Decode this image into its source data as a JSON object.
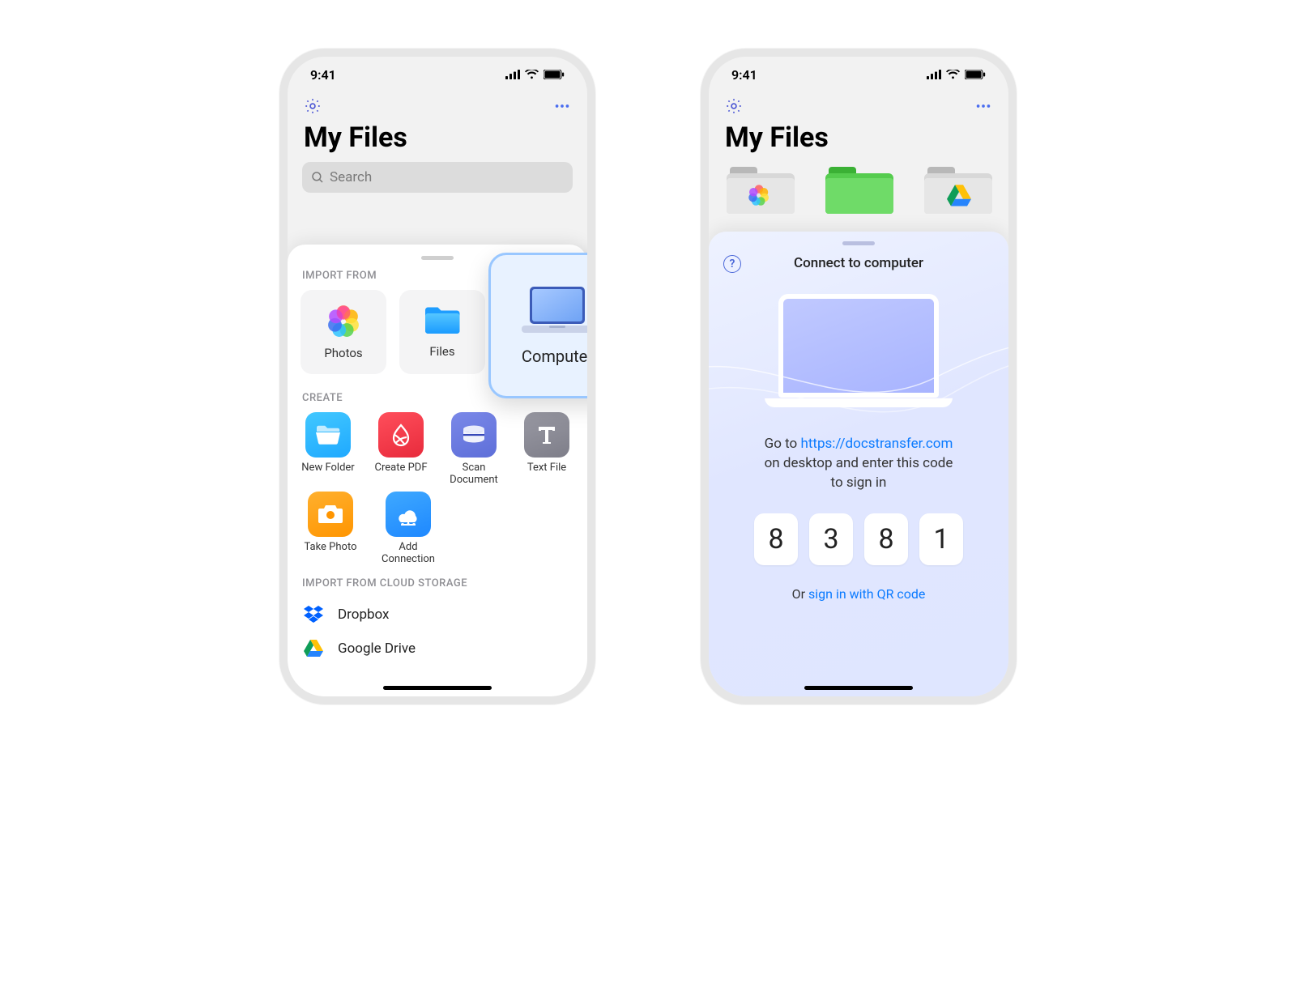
{
  "status_time": "9:41",
  "page_title": "My Files",
  "search_placeholder": "Search",
  "sheet1": {
    "import_label": "IMPORT FROM",
    "photos": "Photos",
    "files": "Files",
    "computer": "Computer",
    "create_label": "CREATE",
    "new_folder": "New Folder",
    "create_pdf": "Create PDF",
    "scan_doc": "Scan Document",
    "text_file": "Text File",
    "take_photo": "Take Photo",
    "add_connection": "Add Connection",
    "cloud_label": "IMPORT FROM CLOUD STORAGE",
    "dropbox": "Dropbox",
    "gdrive": "Google Drive"
  },
  "sheet2": {
    "title": "Connect to computer",
    "go_to": "Go to ",
    "url": "https://docstransfer.com",
    "line2": "on desktop and enter this code",
    "line3": "to sign in",
    "code": [
      "8",
      "3",
      "8",
      "1"
    ],
    "or": "Or ",
    "qr_link": "sign in with QR code"
  }
}
